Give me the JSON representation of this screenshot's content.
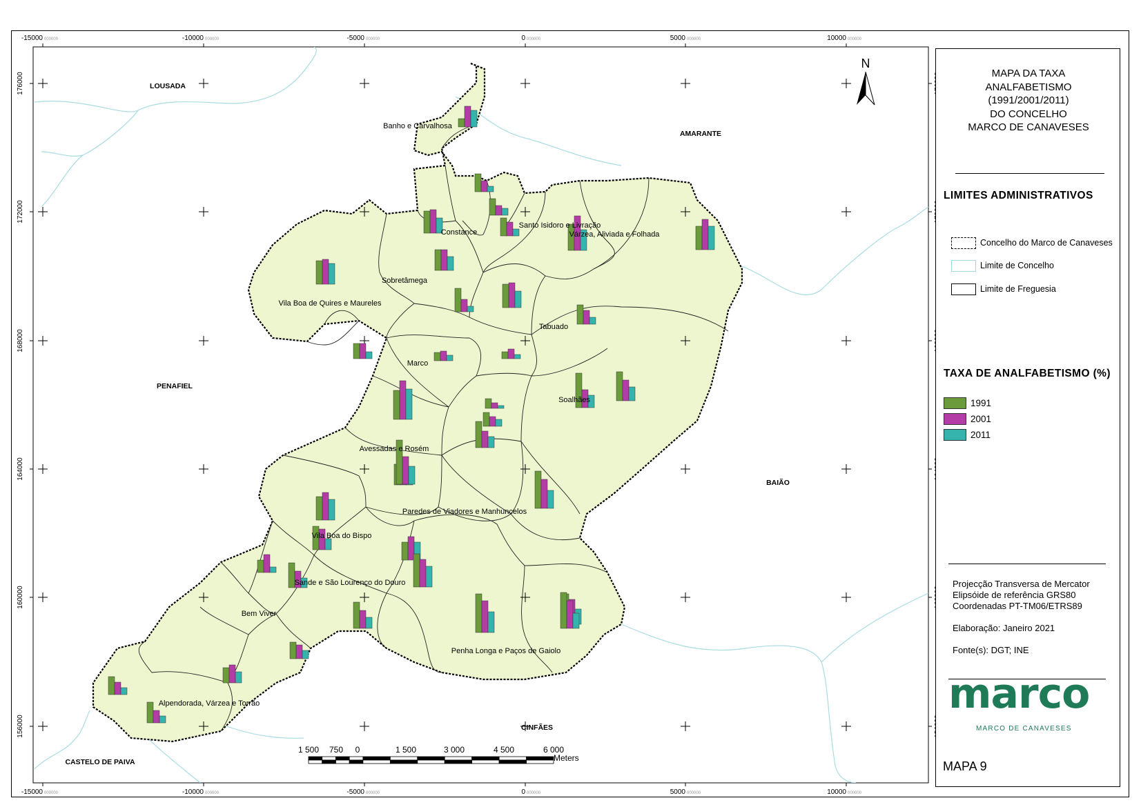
{
  "title_lines": [
    "MAPA DA TAXA",
    "ANALFABETISMO",
    "(1991/2001/2011)",
    "DO CONCELHO",
    "MARCO DE CANAVESES"
  ],
  "admin_title": "LIMITES ADMINISTRATIVOS",
  "admin_legend": [
    {
      "label": "Concelho do Marco de Canaveses",
      "style": "dashed"
    },
    {
      "label": "Limite de Concelho",
      "style": "cyan"
    },
    {
      "label": "Limite de Freguesia",
      "style": "solid"
    }
  ],
  "rate_title": "TAXA DE ANALFABETISMO (%)",
  "years": [
    {
      "label": "1991",
      "color": "#6b9b3a"
    },
    {
      "label": "2001",
      "color": "#b43ca6"
    },
    {
      "label": "2011",
      "color": "#35b4ad"
    }
  ],
  "credits": [
    "Projecção Transversa de Mercator",
    "Elipsóide de referência GRS80",
    "Coordenadas PT-TM06/ETRS89",
    "",
    "Elaboração: Janeiro 2021",
    "",
    "Fonte(s): DGT; INE"
  ],
  "logo": {
    "word": "marco",
    "sub": "MARCO DE CANAVESES"
  },
  "map_number": "MAPA 9",
  "north_label": "N",
  "scale": {
    "ticks": [
      "1 500",
      "750",
      "0",
      "1 500",
      "3 000",
      "4 500",
      "6 000"
    ],
    "unit": "Meters"
  },
  "x_ticks": [
    "-15000",
    "-10000",
    "-5000",
    "0",
    "5000",
    "10000"
  ],
  "y_ticks": [
    "176000",
    "172000",
    "168000",
    "164000",
    "160000",
    "156000"
  ],
  "tick_suffix": "000000",
  "neighbors": [
    "LOUSADA",
    "AMARANTE",
    "PENAFIEL",
    "BAIÃO",
    "CINFÃES",
    "CASTELO DE PAIVA"
  ],
  "parishes": [
    "Banho e Carvalhosa",
    "Constance",
    "Santo Isidoro e Livração",
    "Várzea, Aliviada e Folhada",
    "Sobretâmega",
    "Vila Boa de Quires e Maureles",
    "Tabuado",
    "Marco",
    "Soalhães",
    "Avessadas e Rosém",
    "Paredes de Viadores e Manhuncelos",
    "Vila Boa do Bispo",
    "Sande e São Lourenço do Douro",
    "Bem Viver",
    "Penha Longa e Paços de Gaiolo",
    "Alpendorada, Várzea e Torrão"
  ],
  "bars": [
    {
      "v": [
        12,
        30,
        24
      ]
    },
    {
      "v": [
        26,
        16,
        8
      ]
    },
    {
      "v": [
        32,
        34,
        22
      ]
    },
    {
      "v": [
        24,
        14,
        10
      ]
    },
    {
      "v": [
        26,
        20,
        10
      ]
    },
    {
      "v": [
        38,
        50,
        30
      ]
    },
    {
      "v": [
        30,
        30,
        20
      ]
    },
    {
      "v": [
        34,
        36,
        30
      ]
    },
    {
      "v": [
        34,
        44,
        34
      ]
    },
    {
      "v": [
        34,
        36,
        24
      ]
    },
    {
      "v": [
        34,
        18,
        8
      ]
    },
    {
      "v": [
        28,
        20,
        10
      ]
    },
    {
      "v": [
        50,
        26,
        18
      ]
    },
    {
      "v": [
        22,
        22,
        10
      ]
    },
    {
      "v": [
        12,
        14,
        8
      ]
    },
    {
      "v": [
        10,
        14,
        6
      ]
    },
    {
      "v": [
        30,
        34,
        24
      ]
    },
    {
      "v": [
        42,
        30,
        20
      ]
    },
    {
      "v": [
        42,
        56,
        44
      ]
    },
    {
      "v": [
        20,
        14,
        10
      ]
    },
    {
      "v": [
        26,
        34,
        26
      ]
    },
    {
      "v": [
        14,
        8,
        4
      ]
    },
    {
      "v": [
        54,
        42,
        26
      ]
    },
    {
      "v": [
        64,
        40,
        26
      ]
    },
    {
      "v": [
        38,
        24,
        16
      ]
    },
    {
      "v": [
        34,
        40,
        30
      ]
    },
    {
      "v": [
        34,
        30,
        16
      ]
    },
    {
      "v": [
        18,
        26,
        8
      ]
    },
    {
      "v": [
        36,
        24,
        14
      ]
    },
    {
      "v": [
        38,
        26,
        16
      ]
    },
    {
      "v": [
        48,
        40,
        30
      ]
    },
    {
      "v": [
        44,
        36,
        22
      ]
    },
    {
      "v": [
        56,
        46,
        30
      ]
    },
    {
      "v": [
        52,
        40,
        22
      ]
    },
    {
      "v": [
        24,
        20,
        12
      ]
    },
    {
      "v": [
        26,
        18,
        10
      ]
    },
    {
      "v": [
        22,
        26,
        16
      ]
    },
    {
      "v": [
        30,
        18,
        10
      ]
    }
  ]
}
